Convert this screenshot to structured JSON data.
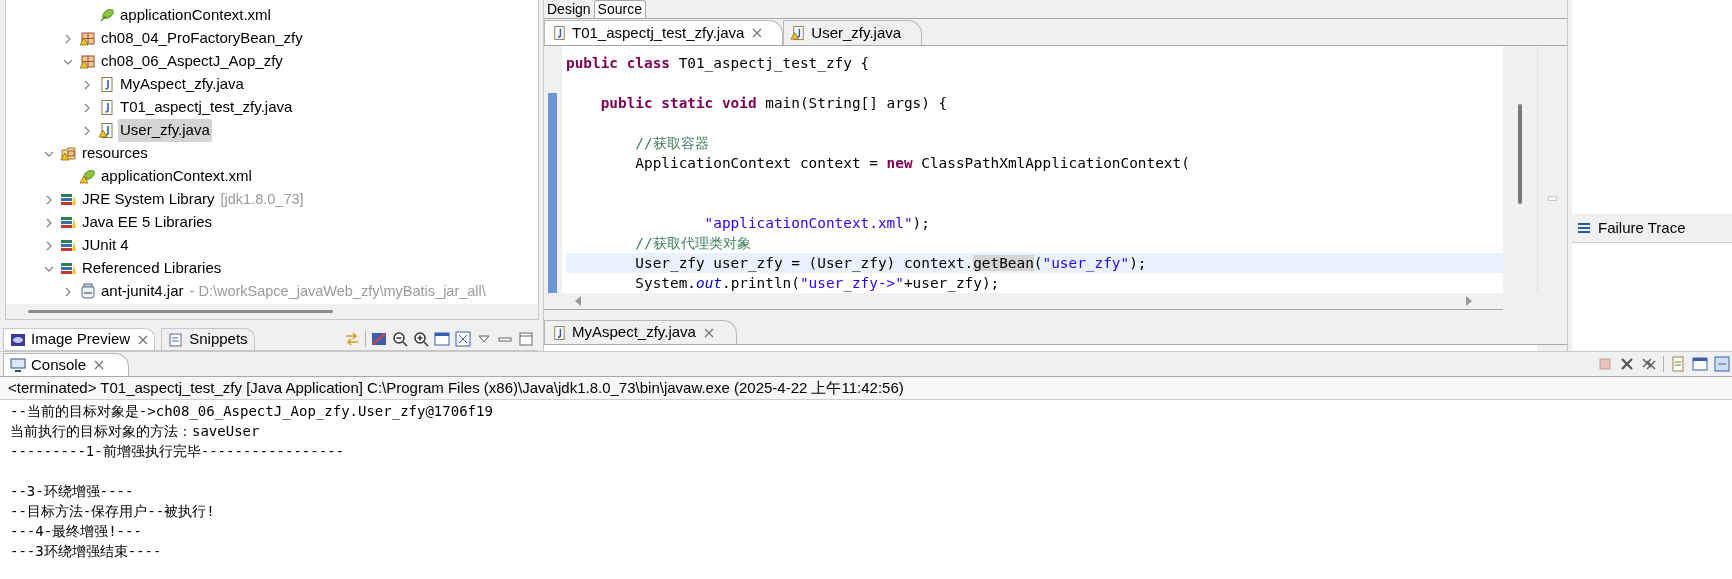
{
  "explorer": {
    "tree": [
      {
        "kind": "offscreen",
        "children": [
          {
            "kind": "offscreen",
            "children": [
              {
                "label": "applicationContext.xml",
                "kind": "xml",
                "selected": false,
                "warning": false
              }
            ]
          },
          {
            "label": "ch08_04_ProFactoryBean_zfy",
            "kind": "package",
            "expanded": false,
            "selected": false,
            "warning": true
          },
          {
            "label": "ch08_06_AspectJ_Aop_zfy",
            "kind": "package",
            "expanded": true,
            "selected": false,
            "warning": true,
            "children": [
              {
                "label": "MyAspect_zfy.java",
                "kind": "java",
                "expanded": false,
                "selected": false,
                "warning": false
              },
              {
                "label": "T01_aspectj_test_zfy.java",
                "kind": "java",
                "expanded": false,
                "selected": false,
                "warning": false
              },
              {
                "label": "User_zfy.java",
                "kind": "java",
                "expanded": false,
                "selected": true,
                "warning": true
              }
            ]
          }
        ]
      },
      {
        "label": "resources",
        "kind": "folder",
        "expanded": true,
        "selected": false,
        "warning": true,
        "children": [
          {
            "label": "applicationContext.xml",
            "kind": "xml",
            "selected": false,
            "warning": true
          }
        ]
      },
      {
        "label": "JRE System Library",
        "decoration": "[jdk1.8.0_73]",
        "kind": "library",
        "expanded": false,
        "selected": false,
        "warning": false
      },
      {
        "label": "Java EE 5 Libraries",
        "kind": "library",
        "expanded": false,
        "selected": false,
        "warning": false
      },
      {
        "label": "JUnit 4",
        "kind": "library",
        "expanded": false,
        "selected": false,
        "warning": false
      },
      {
        "label": "Referenced Libraries",
        "kind": "library",
        "expanded": true,
        "selected": false,
        "warning": false,
        "children": [
          {
            "label": "ant-junit4.jar",
            "decoration": "- D:\\workSapce_javaWeb_zfy\\myBatis_jar_all\\",
            "kind": "jar",
            "expanded": false,
            "selected": false,
            "warning": false
          }
        ]
      }
    ]
  },
  "bottom_left_tabs": [
    {
      "label": "Image Preview",
      "selected": true,
      "closable": true,
      "kind": "image"
    },
    {
      "label": "Snippets",
      "selected": false,
      "closable": false,
      "kind": "snippets"
    }
  ],
  "editor": {
    "mode_tabs": [
      {
        "label": "Design",
        "selected": false
      },
      {
        "label": "Source",
        "selected": true
      }
    ],
    "tabs": [
      {
        "label": "T01_aspectj_test_zfy.java",
        "selected": true,
        "closable": true,
        "warning": false
      },
      {
        "label": "User_zfy.java",
        "selected": false,
        "closable": false,
        "warning": true
      }
    ],
    "lines": [
      {
        "kind": "code",
        "highlighted": false,
        "range_marker": false,
        "tokens": [
          {
            "text": "public class",
            "kind": "keyword"
          },
          {
            "text": " T01_aspectj_test_zfy {",
            "kind": "plain"
          }
        ]
      },
      {
        "kind": "blank",
        "highlighted": false,
        "range_marker": false
      },
      {
        "kind": "code",
        "highlighted": false,
        "range_marker": true,
        "tokens": [
          {
            "text": "    public static void",
            "kind": "keyword"
          },
          {
            "text": " main(String[] args) {",
            "kind": "plain"
          }
        ]
      },
      {
        "kind": "blank",
        "highlighted": false,
        "range_marker": true
      },
      {
        "kind": "code",
        "highlighted": false,
        "range_marker": true,
        "tokens": [
          {
            "text": "        //获取容器",
            "kind": "comment"
          }
        ]
      },
      {
        "kind": "code",
        "highlighted": false,
        "range_marker": true,
        "tokens": [
          {
            "text": "        ApplicationContext context = ",
            "kind": "plain"
          },
          {
            "text": "new",
            "kind": "keyword"
          },
          {
            "text": " ClassPathXmlApplicationContext(",
            "kind": "plain"
          }
        ]
      },
      {
        "kind": "blank",
        "highlighted": false,
        "range_marker": true
      },
      {
        "kind": "blank",
        "highlighted": false,
        "range_marker": true
      },
      {
        "kind": "code",
        "highlighted": false,
        "range_marker": true,
        "tokens": [
          {
            "text": "                \"applicationContext.xml\"",
            "kind": "string"
          },
          {
            "text": ");",
            "kind": "plain"
          }
        ]
      },
      {
        "kind": "code",
        "highlighted": false,
        "range_marker": true,
        "tokens": [
          {
            "text": "        //获取代理类对象",
            "kind": "comment"
          }
        ]
      },
      {
        "kind": "code",
        "highlighted": true,
        "range_marker": true,
        "tokens": [
          {
            "text": "        User_zfy user_zfy = (User_zfy) context.",
            "kind": "plain"
          },
          {
            "text": "getBean",
            "kind": "occurrence"
          },
          {
            "text": "(",
            "kind": "plain"
          },
          {
            "text": "\"user_zfy\"",
            "kind": "string"
          },
          {
            "text": ");",
            "kind": "plain"
          }
        ]
      },
      {
        "kind": "code",
        "highlighted": false,
        "range_marker": true,
        "tokens": [
          {
            "text": "        System.",
            "kind": "plain"
          },
          {
            "text": "out",
            "kind": "field"
          },
          {
            "text": ".println(",
            "kind": "plain"
          },
          {
            "text": "\"user_zfy->\"",
            "kind": "string"
          },
          {
            "text": "+user_zfy);",
            "kind": "plain"
          }
        ]
      }
    ]
  },
  "lower_editor_tabs": [
    {
      "label": "MyAspect_zfy.java",
      "selected": true,
      "closable": true
    }
  ],
  "junit": {
    "failure_trace": "Failure Trace"
  },
  "console": {
    "tab": {
      "label": "Console",
      "selected": true,
      "closable": true
    },
    "status": "<terminated> T01_aspectj_test_zfy [Java Application] C:\\Program Files (x86)\\Java\\jdk1.8.0_73\\bin\\javaw.exe (2025-4-22 上午11:42:56)",
    "lines": [
      {
        "kind": "text",
        "text": "--当前的目标对象是->ch08_06_AspectJ_Aop_zfy.User_zfy@1706f19"
      },
      {
        "kind": "text",
        "text": "当前执行的目标对象的方法：saveUser"
      },
      {
        "kind": "text",
        "text": "---------1-前增强执行完毕-----------------"
      },
      {
        "kind": "blank"
      },
      {
        "kind": "text",
        "text": "--3-环绕增强----"
      },
      {
        "kind": "text",
        "text": "--目标方法-保存用户--被执行!"
      },
      {
        "kind": "text",
        "text": "---4-最终增强!---"
      },
      {
        "kind": "text",
        "text": "---3环绕增强结束----"
      }
    ]
  }
}
